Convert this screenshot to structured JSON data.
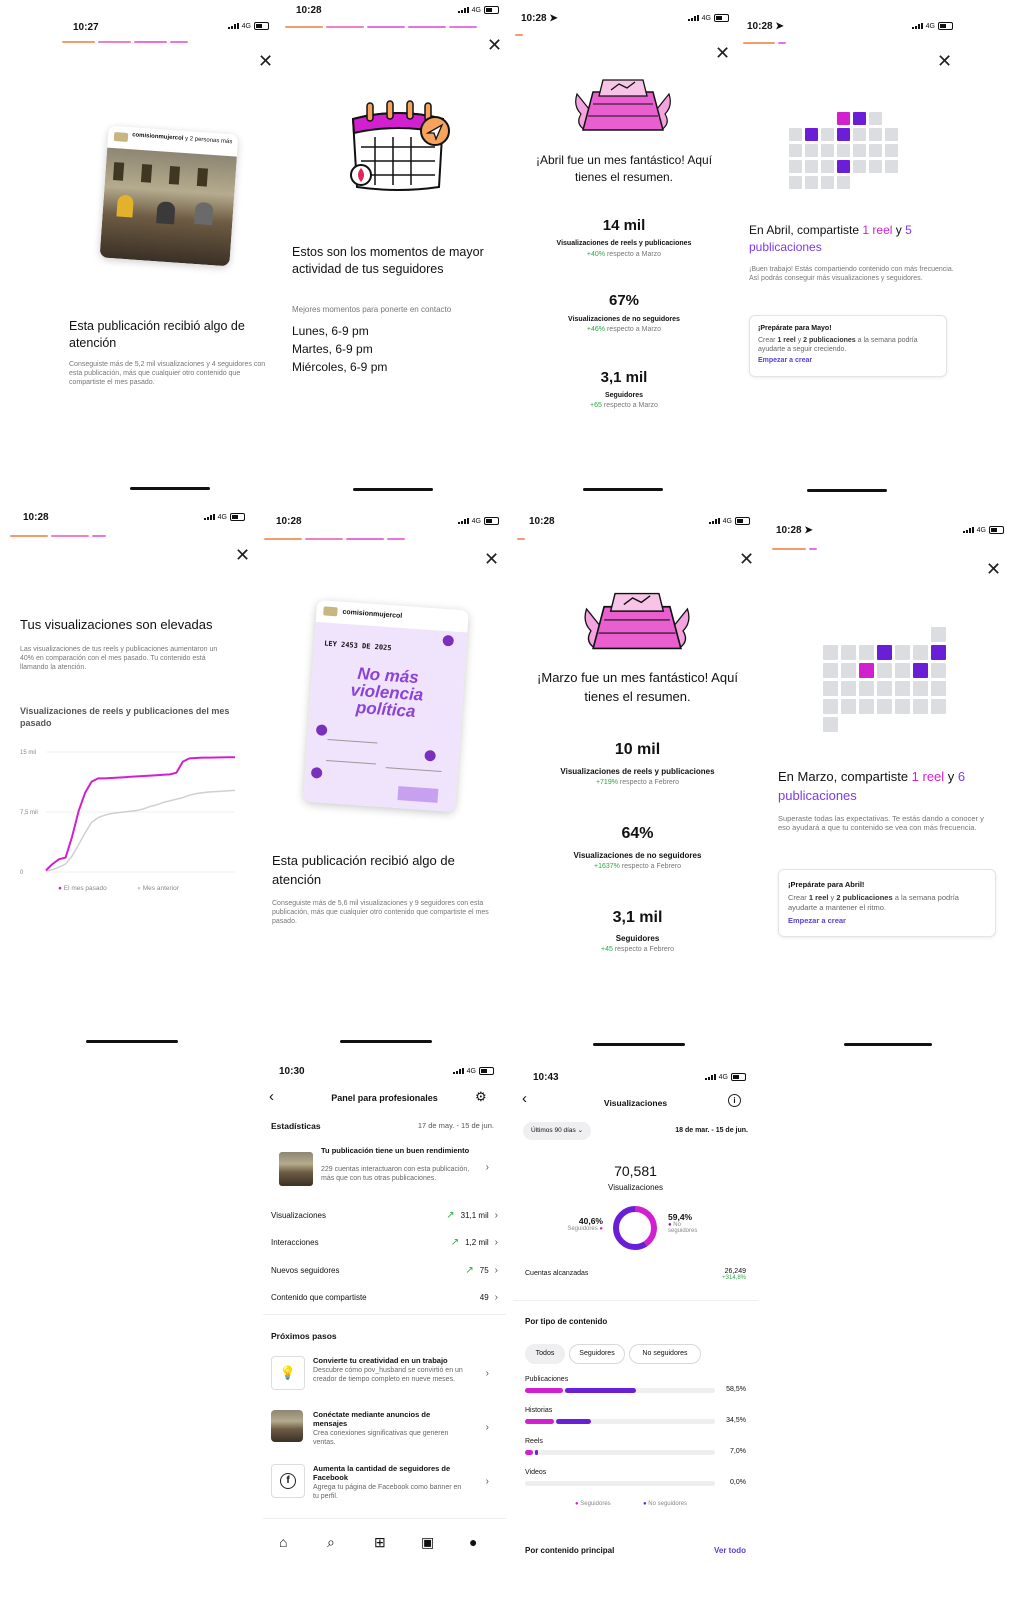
{
  "colors": {
    "pink": "#d21fcf",
    "purple": "#6a1fd6",
    "orange": "#f29b6b",
    "green": "#2aa745",
    "grey_cell": "#dcdde0"
  },
  "p1": {
    "time": "10:27",
    "net": "4G",
    "user": "comisionmujercol",
    "user_suffix": " y 2 personas más",
    "title": "Esta publicación recibió algo de atención",
    "desc": "Conseguiste más de 5,2 mil visualizaciones y 4 seguidores con esta publicación, más que cualquier otro contenido que compartiste el mes pasado."
  },
  "p2": {
    "time": "10:28",
    "net": "4G",
    "title": "Estos son los momentos de mayor actividad de tus seguidores",
    "sub": "Mejores momentos para ponerte en contacto",
    "times": [
      "Lunes, 6-9 pm",
      "Martes, 6-9 pm",
      "Miércoles, 6-9 pm"
    ]
  },
  "p3": {
    "time": "10:28",
    "net": "4G",
    "title": "¡Abril fue un mes fantástico! Aquí tienes el resumen.",
    "stats": [
      {
        "num": "14 mil",
        "label": "Visualizaciones de reels y publicaciones",
        "delta": "+40%",
        "ref": " respecto a Marzo"
      },
      {
        "num": "67%",
        "label": "Visualizaciones de no seguidores",
        "delta": "+46%",
        "ref": " respecto a Marzo"
      },
      {
        "num": "3,1 mil",
        "label": "Seguidores",
        "delta": "+65",
        "ref": " respecto a Marzo"
      }
    ]
  },
  "p4": {
    "time": "10:28",
    "net": "4G",
    "t1": "En Abril, compartiste ",
    "n1": "1 reel",
    "t2": " y ",
    "n2": "5",
    "t3": " publicaciones",
    "desc": "¡Buen trabajo! Estás compartiendo contenido con más frecuencia. Así podrás conseguir más visualizaciones y seguidores.",
    "card_title": "¡Prepárate para Mayo!",
    "card_a": "Crear ",
    "card_b": "1 reel",
    "card_c": " y ",
    "card_d": "2 publicaciones",
    "card_e": " a la semana podría ayudarte a seguir creciendo.",
    "card_link": "Empezar a crear"
  },
  "p5": {
    "time": "10:28",
    "net": "4G",
    "title": "Tus visualizaciones son elevadas",
    "desc": "Las visualizaciones de tus reels y publicaciones aumentaron un 40% en comparación con el mes pasado. Tu contenido está llamando la atención.",
    "chart_title": "Visualizaciones de reels y publicaciones del mes pasado"
  },
  "chart_data": {
    "type": "line",
    "title": "Visualizaciones de reels y publicaciones del mes pasado",
    "y_ticks": [
      "15 mil",
      "7,5 mil",
      "0"
    ],
    "ylim": [
      0,
      15000
    ],
    "x": [
      0,
      1,
      2,
      3,
      4,
      5,
      6,
      7,
      8,
      9,
      10,
      11,
      12,
      13,
      14,
      15,
      16,
      17,
      18,
      19,
      20,
      21,
      22,
      23,
      24,
      25,
      26,
      27,
      28,
      29
    ],
    "series": [
      {
        "name": "El mes pasado",
        "color": "#d21fcf",
        "values": [
          200,
          1000,
          1600,
          1800,
          4400,
          7600,
          9900,
          11300,
          11700,
          11700,
          11750,
          11800,
          11850,
          11900,
          11950,
          12000,
          12050,
          12100,
          12150,
          12200,
          12400,
          13800,
          14200,
          14250,
          14300,
          14300,
          14320,
          14330,
          14340,
          14350
        ]
      },
      {
        "name": "Mes anterior",
        "color": "#cfcfd4",
        "values": [
          100,
          300,
          600,
          1000,
          2000,
          3400,
          4900,
          6200,
          6800,
          7100,
          7300,
          7400,
          7500,
          7600,
          7700,
          7900,
          8200,
          8400,
          8700,
          8900,
          9100,
          9300,
          9600,
          9800,
          9900,
          10000,
          10050,
          10100,
          10150,
          10200
        ]
      }
    ]
  },
  "p6": {
    "time": "10:28",
    "net": "4G",
    "user": "comisionmujercol",
    "poster_law": "LEY 2453 DE 2025",
    "poster_title": "No más violencia política",
    "title": "Esta publicación recibió algo de atención",
    "desc": "Conseguiste más de 5,6 mil visualizaciones y 9 seguidores con esta publicación, más que cualquier otro contenido que compartiste el mes pasado."
  },
  "p7": {
    "time": "10:28",
    "net": "4G",
    "title": "¡Marzo fue un mes fantástico! Aquí tienes el resumen.",
    "stats": [
      {
        "num": "10 mil",
        "label": "Visualizaciones de reels y publicaciones",
        "delta": "+719%",
        "ref": " respecto a Febrero"
      },
      {
        "num": "64%",
        "label": "Visualizaciones de no seguidores",
        "delta": "+1637%",
        "ref": " respecto a Febrero"
      },
      {
        "num": "3,1 mil",
        "label": "Seguidores",
        "delta": "+45",
        "ref": " respecto a Febrero"
      }
    ]
  },
  "p8": {
    "time": "10:28",
    "net": "4G",
    "t1": "En Marzo, compartiste ",
    "n1": "1 reel",
    "t2": " y ",
    "n2": "6",
    "t3": " publicaciones",
    "desc": "Superaste todas las expectativas. Te estás dando a conocer y eso ayudará a que tu contenido se vea con más frecuencia.",
    "card_title": "¡Prepárate para Abril!",
    "card_a": "Crear ",
    "card_b": "1 reel",
    "card_c": " y ",
    "card_d": "2 publicaciones",
    "card_e": " a la semana podría ayudarte a mantener el ritmo.",
    "card_link": "Empezar a crear"
  },
  "p9": {
    "time": "10:30",
    "net": "4G",
    "header": "Panel para profesionales",
    "stats_label": "Estadísticas",
    "range": "17 de may. - 15 de jun.",
    "post_title": "Tu publicación tiene un buen rendimiento",
    "post_desc": "229 cuentas interactuaron con esta publicación, más que con tus otras publicaciones.",
    "rows": [
      {
        "label": "Visualizaciones",
        "value": "31,1 mil",
        "up": true
      },
      {
        "label": "Interacciones",
        "value": "1,2 mil",
        "up": true
      },
      {
        "label": "Nuevos seguidores",
        "value": "75",
        "up": true
      },
      {
        "label": "Contenido que compartiste",
        "value": "49",
        "up": false
      }
    ],
    "next_label": "Próximos pasos",
    "steps": [
      {
        "title": "Convierte tu creatividad en un trabajo",
        "desc": "Descubre cómo pov_husband se convirtió en un creador de tiempo completo en nueve meses."
      },
      {
        "title": "Conéctate mediante anuncios de mensajes",
        "desc": "Crea conexiones significativas que generen ventas."
      },
      {
        "title": "Aumenta la cantidad de seguidores de Facebook",
        "desc": "Agrega tu página de Facebook como banner en tu perfil."
      }
    ]
  },
  "p10": {
    "time": "10:43",
    "net": "4G",
    "header": "Visualizaciones",
    "filter": "Últimos 90 días",
    "range": "18 de mar. - 15 de jun.",
    "total": "70,581",
    "total_label": "Visualizaciones",
    "seg_pct": "40,6%",
    "seg_lbl": "Seguidores",
    "noseg_pct": "59,4%",
    "noseg_lbl": "No seguidores",
    "followers_share": 0.406,
    "reach_label": "Cuentas alcanzadas",
    "reach_value": "26,249",
    "reach_delta": "+314,8%",
    "by_type": "Por tipo de contenido",
    "chips": [
      "Todos",
      "Seguidores",
      "No seguidores"
    ],
    "types": [
      {
        "name": "Publicaciones",
        "pct": "58,5%",
        "value": 0.585,
        "followers": 0.2
      },
      {
        "name": "Historias",
        "pct": "34,5%",
        "value": 0.345,
        "followers": 0.15
      },
      {
        "name": "Reels",
        "pct": "7,0%",
        "value": 0.07,
        "followers": 0.04
      },
      {
        "name": "Videos",
        "pct": "0,0%",
        "value": 0,
        "followers": 0
      }
    ],
    "legend_seg": "Seguidores",
    "legend_noseg": "No seguidores",
    "bottom": "Por contenido principal",
    "see_all": "Ver todo"
  }
}
